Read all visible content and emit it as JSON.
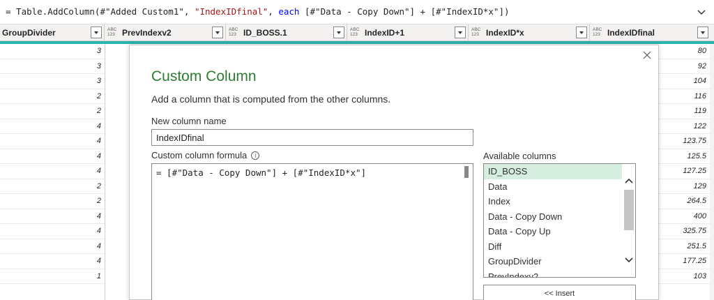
{
  "formula_bar": {
    "prefix": "= Table.AddColumn(#\"Added Custom1\", ",
    "string_literal": "\"IndexIDfinal\"",
    "separator": ", ",
    "keyword": "each",
    "suffix": " [#\"Data - Copy Down\"] + [#\"IndexID*x\"])"
  },
  "columns": [
    {
      "type": "",
      "title": "GroupDivider"
    },
    {
      "type": "ABC\n123",
      "title": "PrevIndexv2"
    },
    {
      "type": "ABC\n123",
      "title": "ID_BOSS.1"
    },
    {
      "type": "ABC\n123",
      "title": "IndexID+1"
    },
    {
      "type": "ABC\n123",
      "title": "IndexID*x"
    },
    {
      "type": "ABC\n123",
      "title": "IndexIDfinal"
    }
  ],
  "group_divider_values": [
    "3",
    "3",
    "3",
    "2",
    "2",
    "4",
    "4",
    "4",
    "4",
    "2",
    "2",
    "4",
    "4",
    "4",
    "4",
    "1"
  ],
  "index_id_final_values": [
    "80",
    "92",
    "104",
    "116",
    "119",
    "122",
    "123.75",
    "125.5",
    "127.25",
    "129",
    "264.5",
    "400",
    "325.75",
    "251.5",
    "177.25",
    "103"
  ],
  "dialog": {
    "title": "Custom Column",
    "subtitle": "Add a column that is computed from the other columns.",
    "new_column_label": "New column name",
    "new_column_value": "IndexIDfinal",
    "formula_label": "Custom column formula",
    "formula_text": "= [#\"Data - Copy Down\"] + [#\"IndexID*x\"]",
    "available_label": "Available columns",
    "available_columns": [
      "ID_BOSS",
      "Data",
      "Index",
      "Data - Copy Down",
      "Data - Copy Up",
      "Diff",
      "GroupDivider",
      "PrevIndexv2"
    ],
    "selected_column": "ID_BOSS",
    "insert_label": "<< Insert"
  },
  "colors": {
    "accent_teal": "#2bb3ad",
    "title_green": "#2e7d32",
    "selection": "#d5eee0"
  }
}
